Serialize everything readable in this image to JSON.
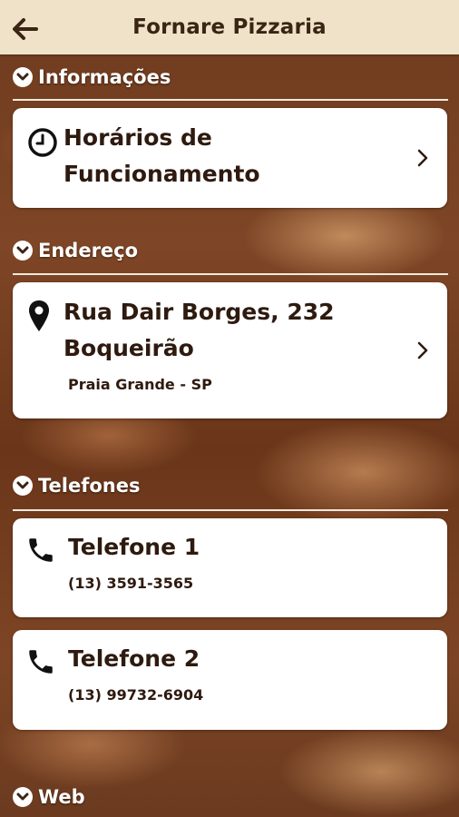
{
  "header": {
    "title": "Fornare Pizzaria"
  },
  "sections": {
    "info": {
      "label": "Informações"
    },
    "address": {
      "label": "Endereço"
    },
    "phones": {
      "label": "Telefones"
    },
    "web": {
      "label": "Web"
    }
  },
  "hours_card": {
    "line1": "Horários de",
    "line2": "Funcionamento"
  },
  "address_card": {
    "line1": "Rua Dair Borges, 232",
    "line2": "Boqueirão",
    "city": "Praia Grande - SP"
  },
  "phone1": {
    "label": "Telefone 1",
    "number": "(13) 3591-3565"
  },
  "phone2": {
    "label": "Telefone 2",
    "number": "(13) 99732-6904"
  },
  "colors": {
    "header_bg": "#efe2c8",
    "text_dark": "#2e1a0f",
    "card_bg": "#ffffff"
  }
}
